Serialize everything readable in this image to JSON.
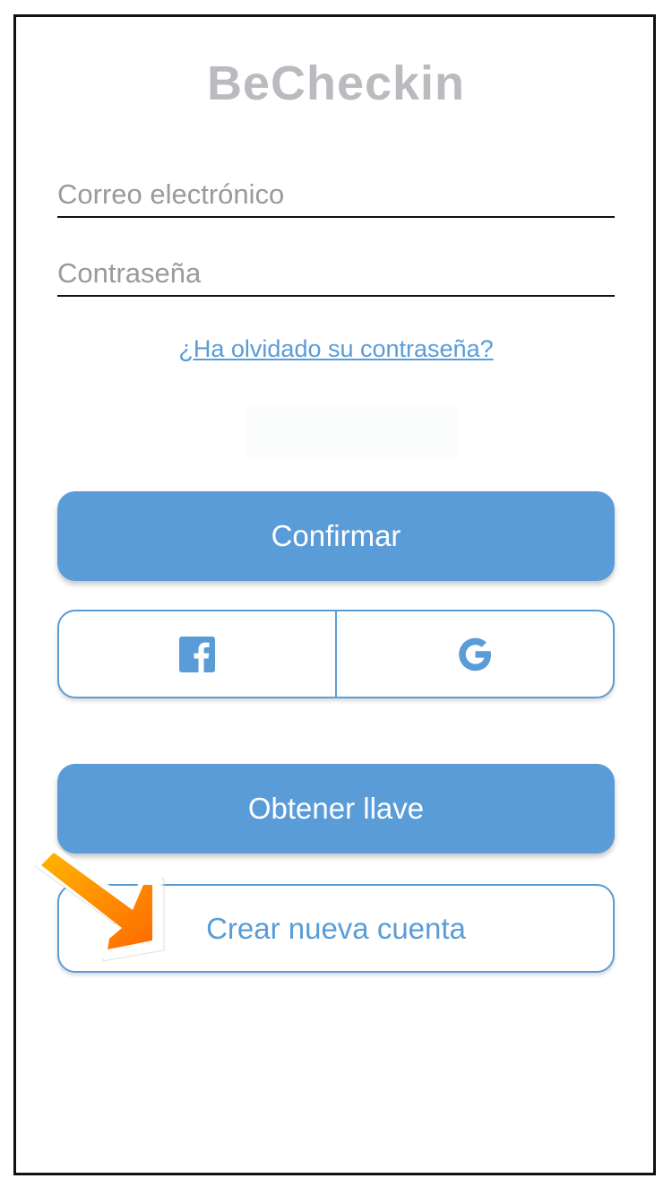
{
  "app": {
    "title": "BeCheckin"
  },
  "login_form": {
    "email_placeholder": "Correo electrónico",
    "password_placeholder": "Contraseña",
    "forgot_password_link": "¿Ha olvidado su contraseña?",
    "confirm_button": "Confirmar"
  },
  "social": {
    "facebook_icon": "facebook-icon",
    "google_icon": "google-icon"
  },
  "actions": {
    "get_key_button": "Obtener llave",
    "create_account_button": "Crear nueva cuenta"
  },
  "annotation": {
    "arrow_icon": "pointing-arrow-icon"
  },
  "colors": {
    "accent": "#5a9cd8",
    "title_gray": "#b9bbbf",
    "arrow_orange": "#ff7a00",
    "arrow_yellow": "#ffb400"
  }
}
